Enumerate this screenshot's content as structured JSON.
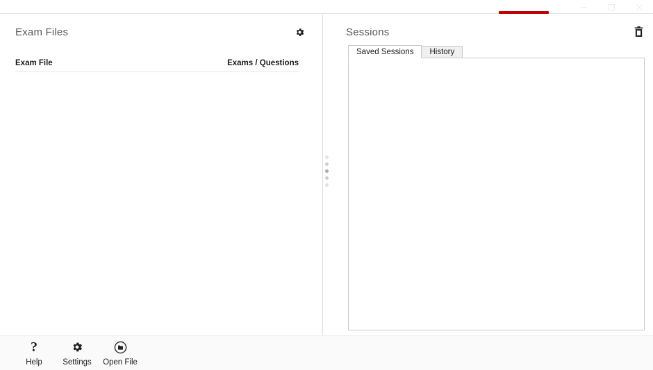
{
  "window": {
    "controls": [
      {
        "name": "minimize",
        "glyph": "minimize-icon"
      },
      {
        "name": "maximize",
        "glyph": "maximize-icon"
      },
      {
        "name": "close",
        "glyph": "close-icon"
      }
    ],
    "accent_color": "#c00000",
    "progress_label": ""
  },
  "left_panel": {
    "title": "Exam Files",
    "settings_icon": "gear-icon",
    "columns": {
      "file": "Exam File",
      "counts": "Exams / Questions"
    },
    "rows": []
  },
  "right_panel": {
    "title": "Sessions",
    "delete_icon": "trash-icon",
    "tabs": [
      {
        "label": "Saved Sessions",
        "active": true
      },
      {
        "label": "History",
        "active": false
      }
    ],
    "items": []
  },
  "splitter": {
    "dot_count": 5
  },
  "toolbar": {
    "items": [
      {
        "label": "Help",
        "icon": "question-mark-icon"
      },
      {
        "label": "Settings",
        "icon": "gear-icon"
      },
      {
        "label": "Open File",
        "icon": "open-file-icon"
      }
    ]
  }
}
